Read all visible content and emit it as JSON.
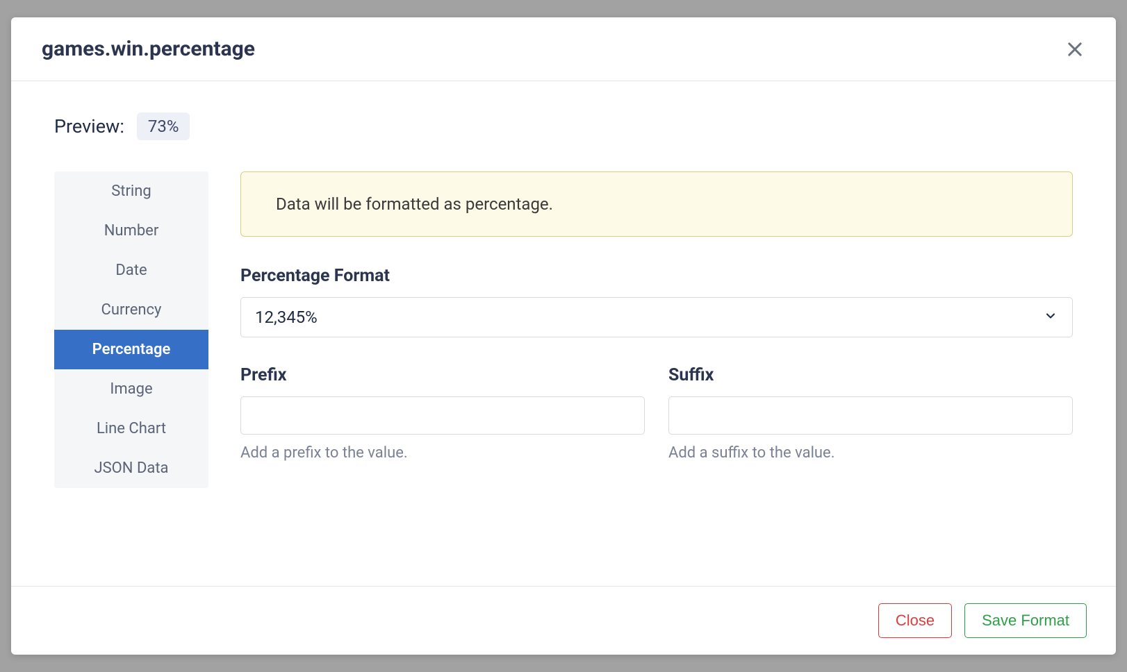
{
  "modal": {
    "title": "games.win.percentage"
  },
  "preview": {
    "label": "Preview:",
    "value": "73%"
  },
  "sidebar": {
    "items": [
      {
        "label": "String",
        "active": false
      },
      {
        "label": "Number",
        "active": false
      },
      {
        "label": "Date",
        "active": false
      },
      {
        "label": "Currency",
        "active": false
      },
      {
        "label": "Percentage",
        "active": true
      },
      {
        "label": "Image",
        "active": false
      },
      {
        "label": "Line Chart",
        "active": false
      },
      {
        "label": "JSON Data",
        "active": false
      }
    ]
  },
  "banner": {
    "text": "Data will be formatted as percentage."
  },
  "format": {
    "label": "Percentage Format",
    "selected": "12,345%"
  },
  "prefix": {
    "label": "Prefix",
    "value": "",
    "helper": "Add a prefix to the value."
  },
  "suffix": {
    "label": "Suffix",
    "value": "",
    "helper": "Add a suffix to the value."
  },
  "footer": {
    "close": "Close",
    "save": "Save Format"
  }
}
